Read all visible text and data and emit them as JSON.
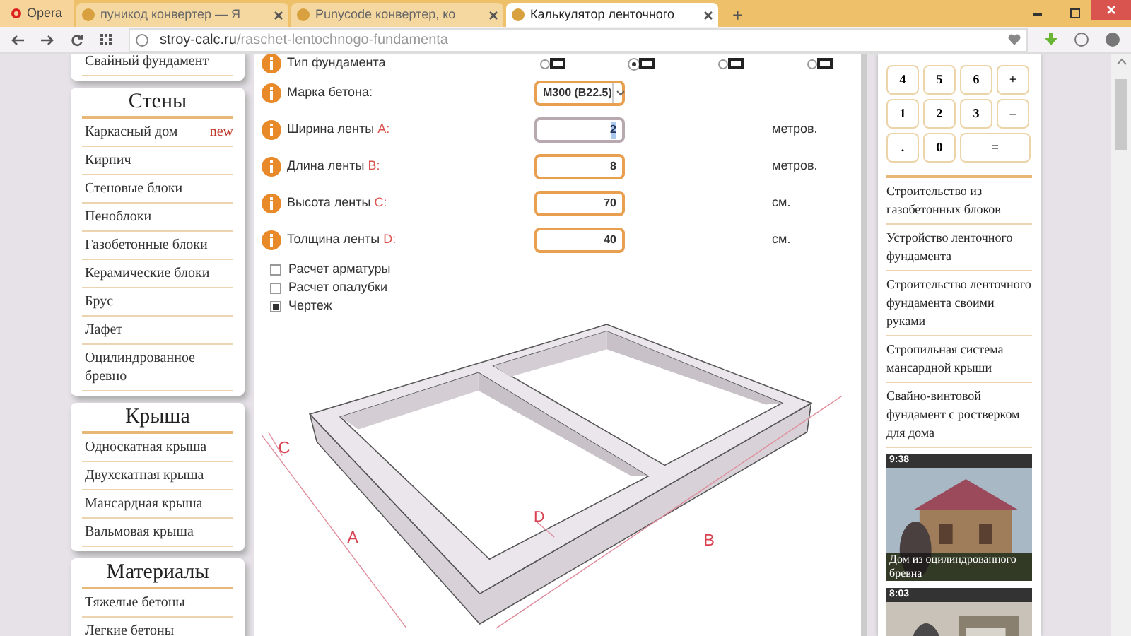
{
  "browser": {
    "menu": "Opera",
    "tabs": [
      {
        "title": "пуникод конвертер — Я",
        "selected": false
      },
      {
        "title": "Punycode конвертер, ко",
        "selected": false
      },
      {
        "title": "Калькулятор ленточного",
        "selected": true
      }
    ],
    "new_tab": "+",
    "url_domain": "stroy-calc.ru",
    "url_path": "/raschet-lentochnogo-fundamenta"
  },
  "sidebar": [
    {
      "items": [
        {
          "label": "Свайный фундамент"
        }
      ]
    },
    {
      "title": "Стены",
      "items": [
        {
          "label": "Каркасный дом",
          "badge": "new"
        },
        {
          "label": "Кирпич"
        },
        {
          "label": "Стеновые блоки"
        },
        {
          "label": "Пеноблоки"
        },
        {
          "label": "Газобетонные блоки"
        },
        {
          "label": "Керамические блоки"
        },
        {
          "label": "Брус"
        },
        {
          "label": "Лафет"
        },
        {
          "label": "Оцилиндрованное бревно"
        }
      ]
    },
    {
      "title": "Крыша",
      "items": [
        {
          "label": "Односкатная крыша"
        },
        {
          "label": "Двухскатная крыша"
        },
        {
          "label": "Мансардная крыша"
        },
        {
          "label": "Вальмовая крыша"
        }
      ]
    },
    {
      "title": "Материалы",
      "items": [
        {
          "label": "Тяжелые бетоны"
        },
        {
          "label": "Легкие бетоны"
        }
      ]
    }
  ],
  "form": {
    "type_label": "Тип фундамента",
    "type_options": [
      {
        "selected": false
      },
      {
        "selected": true
      },
      {
        "selected": false
      },
      {
        "selected": false
      }
    ],
    "fields": [
      {
        "kind": "select",
        "label": "Марка бетона:",
        "value": "М300 (В22.5)"
      },
      {
        "kind": "input",
        "label": "Ширина ленты",
        "letter": "A:",
        "value": "2",
        "unit": "метров.",
        "focused": true
      },
      {
        "kind": "input",
        "label": "Длина ленты",
        "letter": "B:",
        "value": "8",
        "unit": "метров.",
        "focused": false
      },
      {
        "kind": "input",
        "label": "Высота ленты",
        "letter": "C:",
        "value": "70",
        "unit": "см.",
        "focused": false
      },
      {
        "kind": "input",
        "label": "Толщина ленты",
        "letter": "D:",
        "value": "40",
        "unit": "см.",
        "focused": false
      }
    ],
    "checkboxes": [
      {
        "label": "Расчет арматуры",
        "checked": false
      },
      {
        "label": "Расчет опалубки",
        "checked": false
      },
      {
        "label": "Чертеж",
        "checked": true
      }
    ],
    "drawing_labels": {
      "a": "A",
      "b": "B",
      "c": "C",
      "d": "D"
    }
  },
  "calculator": [
    [
      "4",
      "5",
      "6",
      "+"
    ],
    [
      "1",
      "2",
      "3",
      "–"
    ],
    [
      ".",
      "0",
      "="
    ]
  ],
  "articles": [
    "Строительство из газобетонных блоков",
    "Устройство ленточного фундамента",
    "Строительство ленточного фундамента своими руками",
    "Стропильная система мансардной крыши",
    "Свайно-винтовой фундамент с ростверком для дома"
  ],
  "videos": [
    {
      "duration": "9:38",
      "caption": "Дом из оцилиндрованного бревна"
    },
    {
      "duration": "8:03"
    }
  ]
}
